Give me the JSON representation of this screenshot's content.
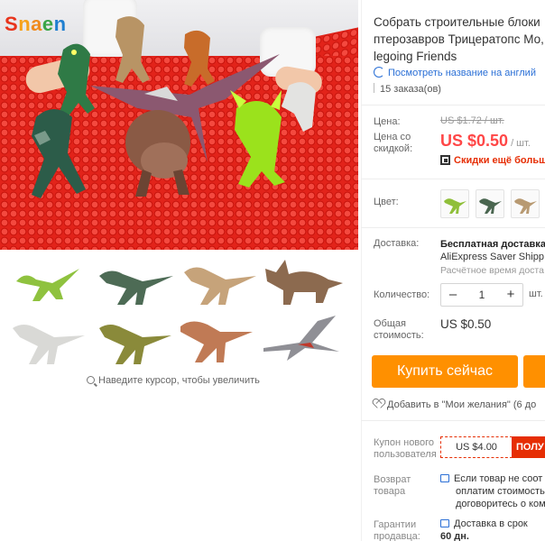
{
  "brand": {
    "logo_text": "Snaen",
    "logo_colors": [
      "#e8341c",
      "#f6a21a",
      "#f08a1d",
      "#3aa547",
      "#1f7fd0"
    ]
  },
  "gallery": {
    "zoom_hint": "Наведите курсор, чтобы увеличить",
    "thumbnails": [
      {
        "icon": "dilophosaurus-figure",
        "color": "#8fc23f"
      },
      {
        "icon": "velociraptor-figure",
        "color": "#4d6b55"
      },
      {
        "icon": "velociraptor-figure",
        "color": "#c6a37a"
      },
      {
        "icon": "triceratops-figure",
        "color": "#8c6a4f"
      },
      {
        "icon": "indominus-figure",
        "color": "#d9d9d6"
      },
      {
        "icon": "velociraptor-figure",
        "color": "#8a8a3a"
      },
      {
        "icon": "tyrannosaurus-figure",
        "color": "#c07a55"
      },
      {
        "icon": "pteranodon-figure",
        "color": "#8f8f95"
      }
    ]
  },
  "product": {
    "title_lines": [
      "Собрать строительные блоки",
      "птерозавров Трицератопс Мо,",
      "legoing Friends"
    ],
    "translate_link": "Посмотреть название на англий",
    "orders": "15 заказа(ов)"
  },
  "pricing": {
    "price_label": "Цена:",
    "old_price": "US $1.72 / шт.",
    "discount_price_label": [
      "Цена со",
      "скидкой:"
    ],
    "price": "US $0.50",
    "price_unit": "/ шт.",
    "app_discount": "Скидки ещё больше"
  },
  "color": {
    "label": "Цвет:",
    "options": [
      "velociraptor-green",
      "velociraptor-dark",
      "velociraptor-tan"
    ]
  },
  "shipping": {
    "label": "Доставка:",
    "free": "Бесплатная доставка",
    "service": "AliExpress Saver Shipp",
    "eta": "Расчётное время доста"
  },
  "quantity": {
    "label": "Количество:",
    "value": "1",
    "minus": "–",
    "plus": "+",
    "unit": "шт."
  },
  "total": {
    "label": [
      "Общая",
      "стоимость:"
    ],
    "value": "US $0.50"
  },
  "actions": {
    "buy_now": "Купить сейчас",
    "wishlist": "Добавить в \"Мои желания\" (6 до"
  },
  "coupon": {
    "label": [
      "Купон нового",
      "пользователя"
    ],
    "value": "US $4.00",
    "button": "ПОЛУ"
  },
  "returns": {
    "label": [
      "Возврат",
      "товара"
    ],
    "text": [
      "Если товар не соот",
      "оплатим стоимость",
      "договоритесь о ком"
    ]
  },
  "guarantee": {
    "label": [
      "Гарантии",
      "продавца:"
    ],
    "text": [
      "Доставка в срок",
      "60 дн."
    ]
  },
  "colors": {
    "price_red": "#ff4747",
    "buy_orange": "#ff9000",
    "link_blue": "#2a6fd6",
    "coupon_red": "#e62e04"
  }
}
